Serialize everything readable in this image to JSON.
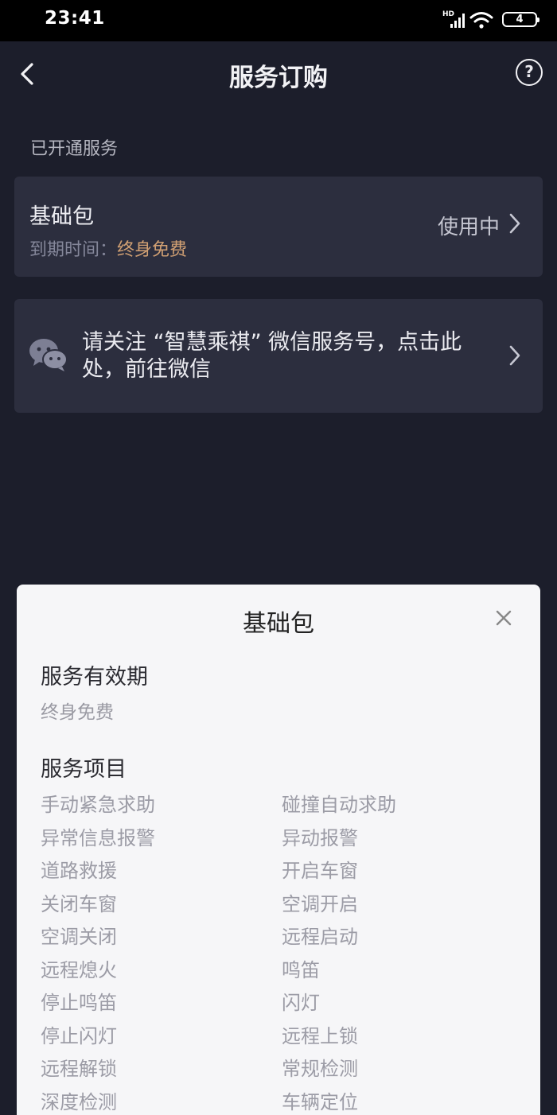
{
  "status_bar": {
    "time": "23:41",
    "network_label": "HD",
    "battery_level": "4"
  },
  "nav": {
    "title": "服务订购",
    "help_glyph": "?"
  },
  "section_label": "已开通服务",
  "subscription_card": {
    "name": "基础包",
    "expire_label": "到期时间：",
    "expire_value": "终身免费",
    "status": "使用中"
  },
  "wechat_card": {
    "icon": "wechat-icon",
    "text": "请关注 “智慧乘祺” 微信服务号，点击此处，前往微信"
  },
  "sheet": {
    "title": "基础包",
    "validity_heading": "服务有效期",
    "validity_value": "终身免费",
    "items_heading": "服务项目",
    "items": [
      "手动紧急求助",
      "碰撞自动求助",
      "异常信息报警",
      "异动报警",
      "道路救援",
      "开启车窗",
      "关闭车窗",
      "空调开启",
      "空调关闭",
      "远程启动",
      "远程熄火",
      "鸣笛",
      "停止鸣笛",
      "闪灯",
      "停止闪灯",
      "远程上锁",
      "远程解锁",
      "常规检测",
      "深度检测",
      "车辆定位"
    ]
  },
  "colors": {
    "background": "#1c1e2b",
    "card": "#2c2e3e",
    "accent": "#d1a073",
    "sheet": "#f6f6f8"
  }
}
